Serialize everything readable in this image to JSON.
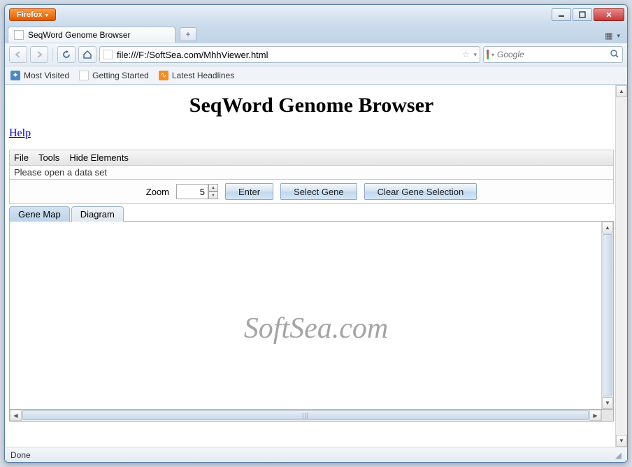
{
  "window": {
    "firefox_label": "Firefox"
  },
  "tab": {
    "title": "SeqWord Genome Browser"
  },
  "nav": {
    "url": "file:///F:/SoftSea.com/MhhViewer.html",
    "search_placeholder": "Google"
  },
  "bookmarks": {
    "most_visited": "Most Visited",
    "getting_started": "Getting Started",
    "latest_headlines": "Latest Headlines"
  },
  "page": {
    "title": "SeqWord Genome Browser",
    "help": "Help",
    "menu": {
      "file": "File",
      "tools": "Tools",
      "hide": "Hide Elements"
    },
    "status": "Please open a data set",
    "zoom_label": "Zoom",
    "zoom_value": "5",
    "buttons": {
      "enter": "Enter",
      "select_gene": "Select Gene",
      "clear_selection": "Clear Gene Selection"
    },
    "tabs": {
      "gene_map": "Gene Map",
      "diagram": "Diagram"
    }
  },
  "statusbar": {
    "text": "Done"
  },
  "watermark": "SoftSea.com"
}
